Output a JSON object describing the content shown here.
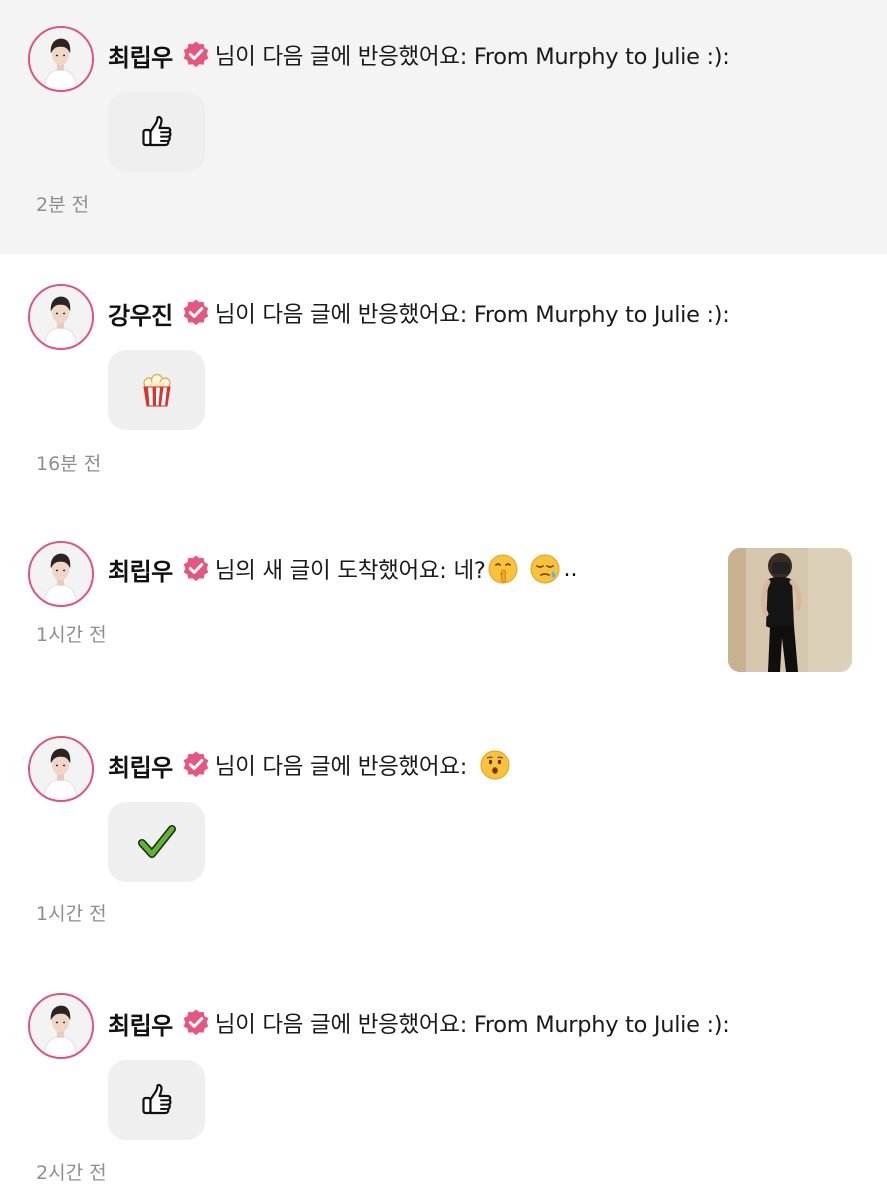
{
  "colors": {
    "avatar_ring": "#e0527e",
    "badge": "#e8557f",
    "unread_bg": "#f4f4f4",
    "reaction_bg": "#efefef",
    "time": "#8e8e8e"
  },
  "notifications": [
    {
      "name": "최립우",
      "message": "님이 다음 글에 반응했어요: From Murphy to Julie :):",
      "reaction_icon": "thumbs-up-icon",
      "time": "2분 전",
      "unread": true
    },
    {
      "name": "강우진",
      "message": "님이 다음 글에 반응했어요: From Murphy to Julie :):",
      "reaction_icon": "popcorn-icon",
      "time": "16분 전",
      "unread": false
    },
    {
      "name": "최립우",
      "message": "님의 새 글이 도착했어요: 네?",
      "inline_icons": [
        "shushing-face-icon",
        "sleepy-face-icon"
      ],
      "message_tail": "..",
      "time": "1시간 전",
      "has_thumbnail": true,
      "unread": false
    },
    {
      "name": "최립우",
      "message": "님이 다음 글에 반응했어요:",
      "inline_icons": [
        "hushed-face-icon"
      ],
      "reaction_icon": "check-mark-icon",
      "time": "1시간 전",
      "unread": false
    },
    {
      "name": "최립우",
      "message": "님이 다음 글에 반응했어요: From Murphy to Julie :):",
      "reaction_icon": "thumbs-up-icon",
      "time": "2시간 전",
      "unread": false
    }
  ]
}
